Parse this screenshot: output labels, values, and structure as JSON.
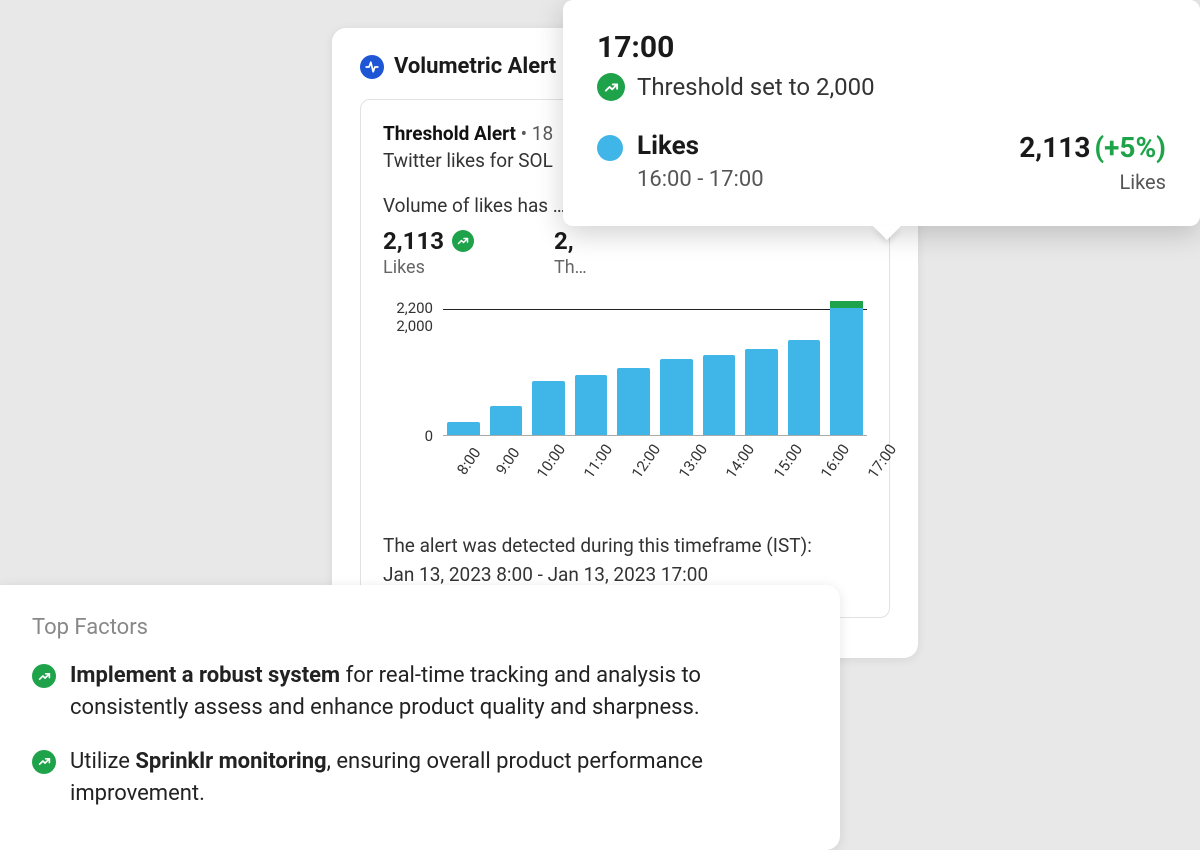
{
  "alert": {
    "title": "Volumetric Alert",
    "threshold_label": "Threshold Alert",
    "threshold_meta": " • 18",
    "subject_line": "Twitter likes for SOL",
    "volume_sentence": "Volume of likes has …",
    "metric_value": "2,113",
    "metric_label": "Likes",
    "metric2_value": "2,",
    "metric2_label": "Th…",
    "timeframe_line1": "The alert was detected during this timeframe (IST):",
    "timeframe_line2": "Jan 13, 2023 8:00 - Jan 13, 2023 17:00"
  },
  "chart_data": {
    "type": "bar",
    "categories": [
      "8:00",
      "9:00",
      "10:00",
      "11:00",
      "12:00",
      "13:00",
      "14:00",
      "15:00",
      "16:00",
      "17:00"
    ],
    "values": [
      200,
      450,
      850,
      950,
      1050,
      1200,
      1250,
      1350,
      1500,
      2113
    ],
    "threshold": 2000,
    "ylim": [
      0,
      2200
    ],
    "y_ticks": [
      "2,200",
      "2,000",
      "0"
    ],
    "ylabel": "",
    "xlabel": "",
    "title": ""
  },
  "tooltip": {
    "time": "17:00",
    "threshold_text": "Threshold set to 2,000",
    "series_label": "Likes",
    "time_range": "16:00 - 17:00",
    "value": "2,113",
    "delta": "(+5%)",
    "unit": "Likes"
  },
  "factors": {
    "title": "Top Factors",
    "items": [
      {
        "bold": "Implement a robust system",
        "rest": " for real-time tracking and analysis to consistently assess and enhance product quality and sharpness."
      },
      {
        "pre": "Utilize ",
        "bold": "Sprinklr monitoring",
        "rest": ", ensuring overall product performance improvement."
      }
    ]
  },
  "colors": {
    "bar": "#3fb5e8",
    "accent_green": "#1fa34a",
    "header_icon": "#1e56d6"
  }
}
